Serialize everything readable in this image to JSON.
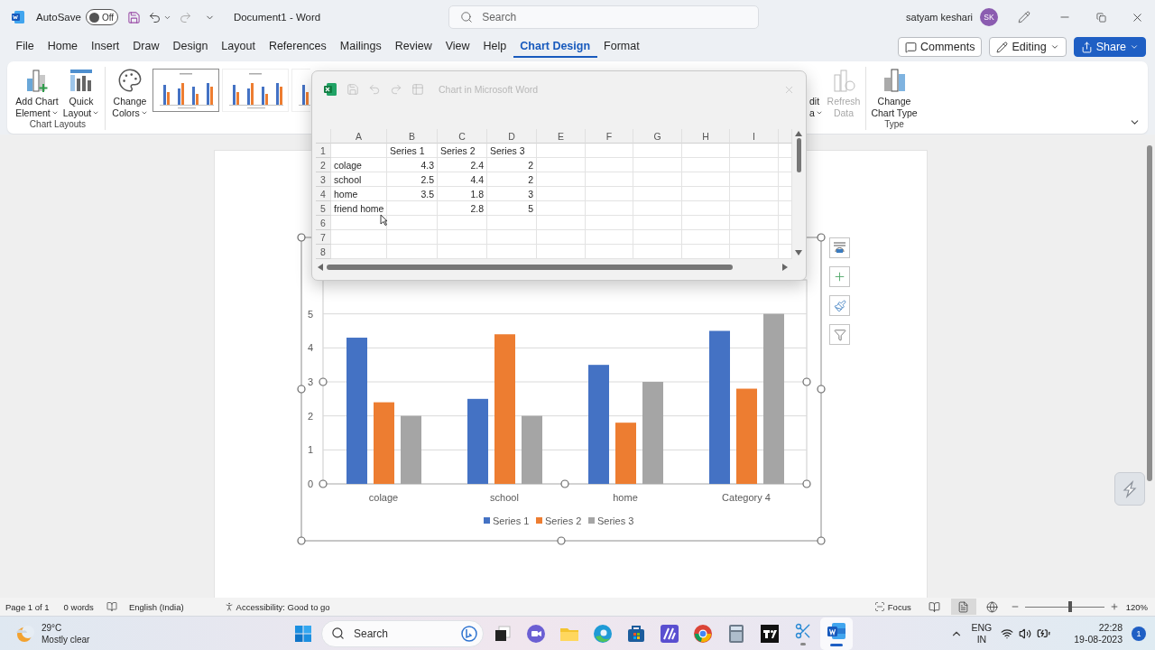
{
  "title_bar": {
    "autosave_label": "AutoSave",
    "autosave": {
      "label": "Off",
      "on": false
    },
    "document_title": "Document1  -  Word",
    "search": {
      "placeholder": "Search"
    },
    "user_name": "satyam keshari",
    "avatar_initials": "SK"
  },
  "menu_tabs": [
    {
      "label": "File",
      "selected": false
    },
    {
      "label": "Home",
      "selected": false
    },
    {
      "label": "Insert",
      "selected": false
    },
    {
      "label": "Draw",
      "selected": false
    },
    {
      "label": "Design",
      "selected": false
    },
    {
      "label": "Layout",
      "selected": false
    },
    {
      "label": "References",
      "selected": false
    },
    {
      "label": "Mailings",
      "selected": false
    },
    {
      "label": "Review",
      "selected": false
    },
    {
      "label": "View",
      "selected": false
    },
    {
      "label": "Help",
      "selected": false
    },
    {
      "label": "Chart Design",
      "selected": true
    },
    {
      "label": "Format",
      "selected": false
    }
  ],
  "header_buttons": [
    {
      "kind": "comments",
      "label": "Comments",
      "dropdown": false
    },
    {
      "kind": "editing",
      "label": "Editing",
      "dropdown": true
    },
    {
      "kind": "share",
      "label": "Share",
      "dropdown": true
    }
  ],
  "ribbon": {
    "groups": [
      {
        "label": "Chart Layouts",
        "items": [
          {
            "kind": "add-chart-element",
            "label": "Add Chart\nElement",
            "dropdown": true,
            "disabled": false
          },
          {
            "kind": "quick-layout",
            "label": "Quick\nLayout",
            "dropdown": true,
            "disabled": false
          }
        ]
      },
      {
        "items": [
          {
            "kind": "change-colors",
            "label": "Change\nColors",
            "dropdown": true,
            "disabled": false
          },
          {
            "kind": "style-gallery",
            "styles": [
              {
                "selected": true
              },
              {
                "selected": false
              },
              {
                "selected": false
              }
            ]
          }
        ]
      },
      {
        "items": [
          {
            "kind": "edit-data",
            "label": "dit\na",
            "dropdown": true,
            "disabled": false
          },
          {
            "kind": "refresh-data",
            "label": "Refresh\nData",
            "dropdown": false,
            "disabled": true
          }
        ]
      },
      {
        "label": "Type",
        "items": [
          {
            "kind": "change-chart-type",
            "label": "Change\nChart Type",
            "dropdown": false,
            "disabled": false
          }
        ]
      }
    ]
  },
  "document": {
    "chart": {
      "chart_data": {
        "type": "bar",
        "categories": [
          "colage",
          "school",
          "home",
          "Category 4"
        ],
        "series": [
          {
            "name": "Series 1",
            "color": "#4472c4",
            "values": [
              4.3,
              2.5,
              3.5,
              4.5
            ]
          },
          {
            "name": "Series 2",
            "color": "#ed7d31",
            "values": [
              2.4,
              4.4,
              1.8,
              2.8
            ]
          },
          {
            "name": "Series 3",
            "color": "#a5a5a5",
            "values": [
              2,
              2,
              3,
              5
            ]
          }
        ],
        "ylim": [
          0,
          6
        ],
        "yticks": [
          {
            "value": 0,
            "label": "0"
          },
          {
            "value": 1,
            "label": "1"
          },
          {
            "value": 2,
            "label": "2"
          },
          {
            "value": 3,
            "label": "3"
          },
          {
            "value": 4,
            "label": "4"
          },
          {
            "value": 5,
            "label": "5"
          }
        ],
        "grid": true,
        "legend": "bottom"
      }
    }
  },
  "excel_window": {
    "title": "Chart in Microsoft Word",
    "columns": [
      "A",
      "B",
      "C",
      "D",
      "E",
      "F",
      "G",
      "H",
      "I"
    ],
    "rows": [
      {
        "number": "1",
        "kind": "header",
        "B": "Series 1",
        "C": "Series 2",
        "D": "Series 3"
      },
      {
        "number": "2",
        "kind": "data",
        "A": "colage",
        "B": "4.3",
        "C": "2.4",
        "D": "2"
      },
      {
        "number": "3",
        "kind": "data",
        "A": "school",
        "B": "2.5",
        "C": "4.4",
        "D": "2"
      },
      {
        "number": "4",
        "kind": "data",
        "A": "home",
        "B": "3.5",
        "C": "1.8",
        "D": "3"
      },
      {
        "number": "5",
        "kind": "data",
        "A": "friend home",
        "C": "2.8",
        "D": "5"
      },
      {
        "number": "6",
        "kind": "empty"
      },
      {
        "number": "7",
        "kind": "empty"
      },
      {
        "number": "8",
        "kind": "empty"
      }
    ]
  },
  "status_bar": {
    "page": "Page 1 of 1",
    "words": "0 words",
    "language": "English (India)",
    "accessibility": "Accessibility: Good to go",
    "focus": "Focus",
    "views": [
      {
        "kind": "read",
        "selected": false
      },
      {
        "kind": "print",
        "selected": true
      },
      {
        "kind": "web",
        "selected": false
      }
    ],
    "zoom": {
      "level": 0.57,
      "reading": "120%"
    }
  },
  "taskbar": {
    "temperature": "29°C",
    "condition": "Mostly clear",
    "search": {
      "placeholder": "Search"
    },
    "apps": [
      {
        "kind": "task-view",
        "running": false,
        "active": false
      },
      {
        "kind": "chat",
        "running": false,
        "active": false
      },
      {
        "kind": "folder",
        "running": false,
        "active": false
      },
      {
        "kind": "edge",
        "running": false,
        "active": false
      },
      {
        "kind": "store",
        "running": false,
        "active": false
      },
      {
        "kind": "gradient-tile",
        "running": false,
        "active": false
      },
      {
        "kind": "chrome",
        "running": false,
        "active": false
      },
      {
        "kind": "calculator",
        "running": false,
        "active": false
      },
      {
        "kind": "dark-tile",
        "running": false,
        "active": false
      },
      {
        "kind": "snipping",
        "running": true,
        "active": false
      },
      {
        "kind": "word",
        "running": true,
        "active": true
      }
    ],
    "language_top": "ENG",
    "language_bottom": "IN",
    "time": "22:28",
    "date": "19-08-2023",
    "notifications": "1"
  }
}
